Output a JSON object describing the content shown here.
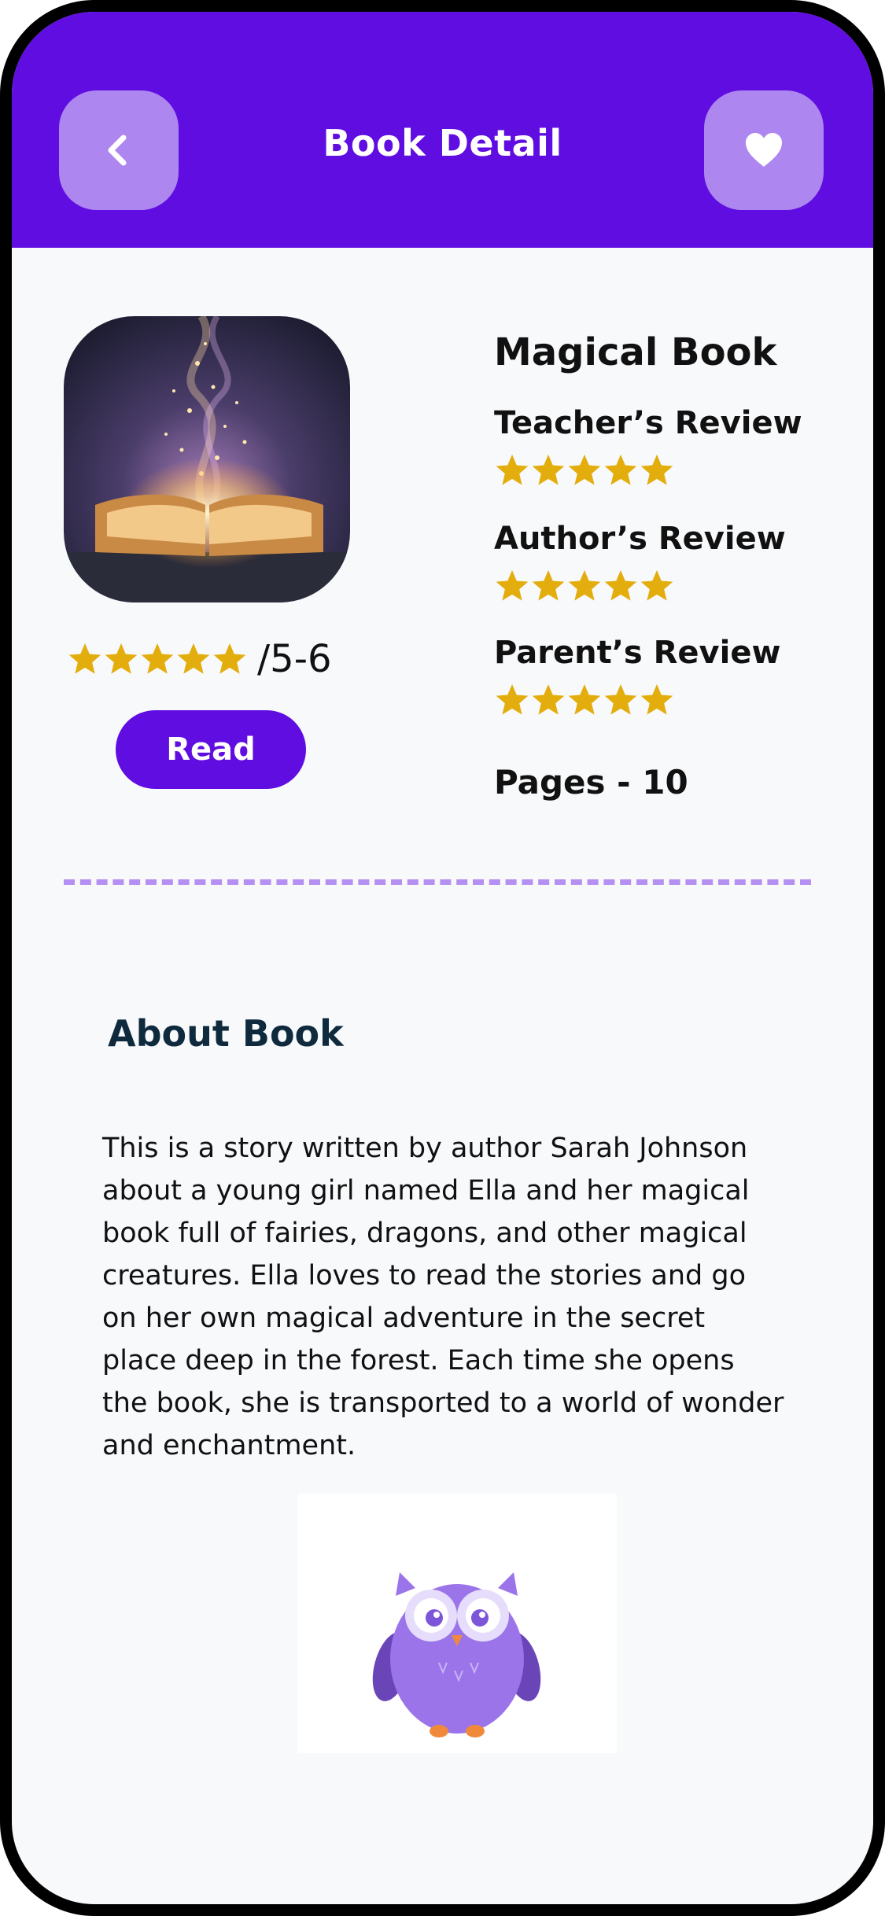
{
  "header": {
    "title": "Book Detail",
    "back_icon": "chevron-left-icon",
    "favorite_icon": "heart-icon",
    "bg_color": "#5f0de1",
    "button_color": "#ae86ef"
  },
  "book": {
    "title": "Magical Book",
    "rating_stars": 5,
    "age_range": "/5-6",
    "read_label": "Read",
    "pages_label": "Pages - 10"
  },
  "reviews": [
    {
      "label": "Teacher’s Review",
      "stars": 5
    },
    {
      "label": "Author’s Review",
      "stars": 5
    },
    {
      "label": "Parent’s Review",
      "stars": 5
    }
  ],
  "about": {
    "title": "About Book",
    "text": "This is a story written by author Sarah Johnson about a young girl named Ella and her magical book full of fairies, dragons, and other magical creatures. Ella loves to read the stories and go on her own magical adventure in the secret place deep in the forest. Each time she opens the book, she is transported to a world of wonder and enchantment."
  },
  "colors": {
    "accent": "#5f0de1",
    "star": "#e3ae0d",
    "divider": "#b390f2",
    "heading_dark": "#0f2a3d"
  }
}
